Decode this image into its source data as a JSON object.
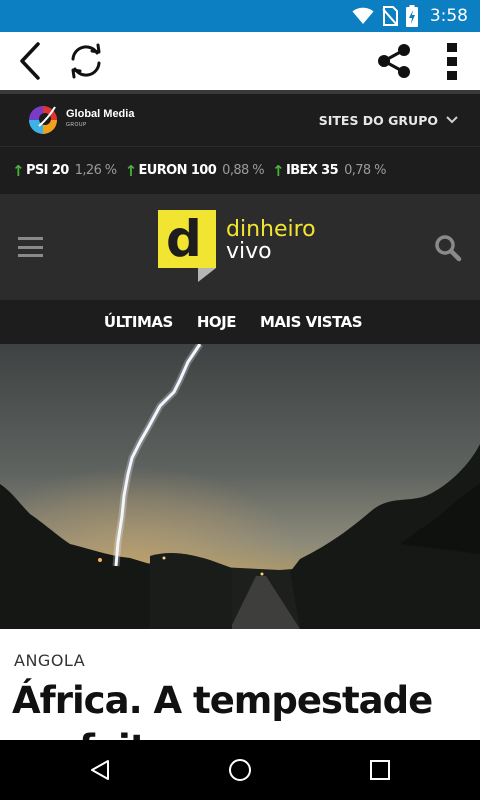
{
  "status_bar": {
    "time": "3:58",
    "icons": [
      "wifi-icon",
      "no-sim-icon",
      "battery-charging-icon"
    ],
    "color": "#0c7fc2"
  },
  "toolbar": {
    "icons": [
      "back-arrow-icon",
      "refresh-icon",
      "share-icon",
      "overflow-menu-icon"
    ]
  },
  "site_header": {
    "brand_name": "Global Media",
    "brand_sub": "GROUP",
    "sites_label": "SITES DO GRUPO",
    "sites_icon": "chevron-down-icon"
  },
  "ticker": [
    {
      "name": "PSI 20",
      "value": "1,26 %",
      "direction": "up"
    },
    {
      "name": "EURON 100",
      "value": "0,88 %",
      "direction": "up"
    },
    {
      "name": "IBEX 35",
      "value": "0,78 %",
      "direction": "up"
    }
  ],
  "masthead": {
    "logo_letter": "d",
    "logo_word_1": "dinheiro",
    "logo_word_2": "vivo",
    "accent_color": "#f2e531",
    "menu_icon": "hamburger-menu-icon",
    "search_icon": "search-icon"
  },
  "site_nav": {
    "items": [
      "ÚLTIMAS",
      "HOJE",
      "MAIS VISTAS"
    ]
  },
  "article": {
    "category": "ANGOLA",
    "headline": "África. A tempestade perfeita para os",
    "image": "lightning-over-road-photo"
  },
  "system_nav": {
    "icons": [
      "back-triangle-icon",
      "home-circle-icon",
      "recents-square-icon"
    ]
  }
}
